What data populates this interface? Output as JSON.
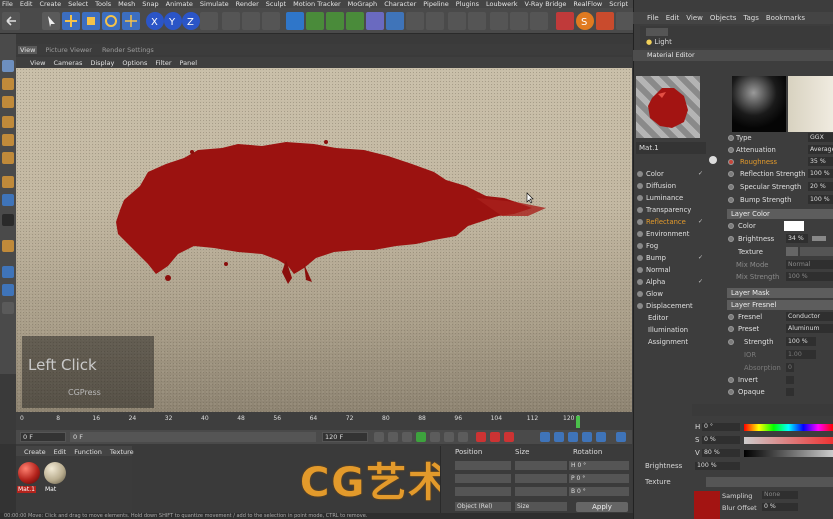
{
  "menubar": [
    "File",
    "Edit",
    "Create",
    "Select",
    "Tools",
    "Mesh",
    "Snap",
    "Animate",
    "Simulate",
    "Render",
    "Sculpt",
    "Motion Tracker",
    "MoGraph",
    "Character",
    "Pipeline",
    "Plugins",
    "Loubwerk",
    "V-Ray Bridge",
    "RealFlow",
    "Script",
    "Window",
    "Help"
  ],
  "viewport_tabs": [
    "View",
    "Picture Viewer",
    "Render Settings"
  ],
  "viewport_menu": [
    "View",
    "Cameras",
    "Display",
    "Options",
    "Filter",
    "Panel"
  ],
  "overlay": {
    "left_click": "Left Click",
    "brand": "CGPress"
  },
  "timeline": {
    "ticks": [
      "0",
      "8",
      "16",
      "24",
      "32",
      "40",
      "48",
      "56",
      "64",
      "72",
      "80",
      "88",
      "96",
      "104",
      "112",
      "120 F"
    ],
    "current_frame": "0 F",
    "start_field": "0 F",
    "frame_field": "0 F",
    "end_field": "120 F",
    "right_field": "120 F"
  },
  "material_manager": {
    "menu": [
      "Create",
      "Edit",
      "Function",
      "Texture"
    ],
    "materials": [
      {
        "name": "Mat.1",
        "color": "#b3231c"
      },
      {
        "name": "Mat",
        "color": "#b9ad8f"
      }
    ]
  },
  "watermark": "CG艺术社",
  "coords": {
    "headers": [
      "Position",
      "Size",
      "Rotation"
    ],
    "rows": [
      {
        "pos": "",
        "size": "",
        "rot_label": "H",
        "rot": "0 °"
      },
      {
        "pos": "",
        "size": "",
        "rot_label": "P",
        "rot": "0 °"
      },
      {
        "pos": "",
        "size": "",
        "rot_label": "B",
        "rot": "0 °"
      }
    ],
    "mode": "Object (Rel)",
    "size_mode": "Size",
    "apply": "Apply"
  },
  "status": "00:00:00   Move: Click and drag to move elements. Hold down SHIFT to quantize movement / add to the selection in point mode, CTRL to remove.",
  "right_panel": {
    "menu": [
      "File",
      "Edit",
      "View",
      "Objects",
      "Tags",
      "Bookmarks"
    ],
    "object": "Light",
    "material_editor_title": "Material Editor",
    "material_name": "Mat.1",
    "channels": [
      {
        "name": "Color",
        "checked": true
      },
      {
        "name": "Diffusion",
        "checked": false
      },
      {
        "name": "Luminance",
        "checked": false
      },
      {
        "name": "Transparency",
        "checked": false
      },
      {
        "name": "Reflectance",
        "checked": true
      },
      {
        "name": "Environment",
        "checked": false
      },
      {
        "name": "Fog",
        "checked": false
      },
      {
        "name": "Bump",
        "checked": true
      },
      {
        "name": "Normal",
        "checked": false
      },
      {
        "name": "Alpha",
        "checked": true
      },
      {
        "name": "Glow",
        "checked": false
      },
      {
        "name": "Displacement",
        "checked": false
      },
      {
        "name": "Editor",
        "checked": false
      },
      {
        "name": "Illumination",
        "checked": false
      },
      {
        "name": "Assignment",
        "checked": false
      }
    ],
    "props": {
      "type_label": "Type",
      "type_val": "GGX",
      "atten_label": "Attenuation",
      "atten_val": "Average",
      "rough_label": "Roughness",
      "rough_val": "35 %",
      "refl_label": "Reflection Strength",
      "refl_val": "100 %",
      "spec_label": "Specular Strength",
      "spec_val": "20 %",
      "bump_label": "Bump Strength",
      "bump_val": "100 %",
      "layer_color": "Layer Color",
      "color_label": "Color",
      "bright_label": "Brightness",
      "bright_val": "34 %",
      "texture_label": "Texture",
      "mixmode_label": "Mix Mode",
      "mixmode_val": "Normal",
      "mixstr_label": "Mix Strength",
      "mixstr_val": "100 %",
      "layer_mask": "Layer Mask",
      "layer_fresnel": "Layer Fresnel",
      "fresnel_label": "Fresnel",
      "fresnel_val": "Conductor",
      "preset_label": "Preset",
      "preset_val": "Aluminum",
      "strength_label": "Strength",
      "strength_val": "100 %",
      "ior_label": "IOR",
      "ior_val": "1.00",
      "absorption_label": "Absorption",
      "absorption_val": "0",
      "invert_label": "Invert",
      "opaque_label": "Opaque"
    },
    "picker": {
      "h_label": "H",
      "h_val": "0 °",
      "s_label": "S",
      "s_val": "0 %",
      "v_label": "V",
      "v_val": "80 %",
      "brightness_label": "Brightness",
      "brightness_val": "100 %",
      "texture_label": "Texture",
      "sampling_label": "Sampling",
      "sampling_val": "None",
      "bluroffset_label": "Blur Offset",
      "bluroffset_val": "0 %",
      "blurscale_label": "Blur Scale",
      "blurscale_val": "0 %"
    }
  },
  "colors": {
    "blood": "#9b1210",
    "accent_orange": "#e39a2b"
  }
}
